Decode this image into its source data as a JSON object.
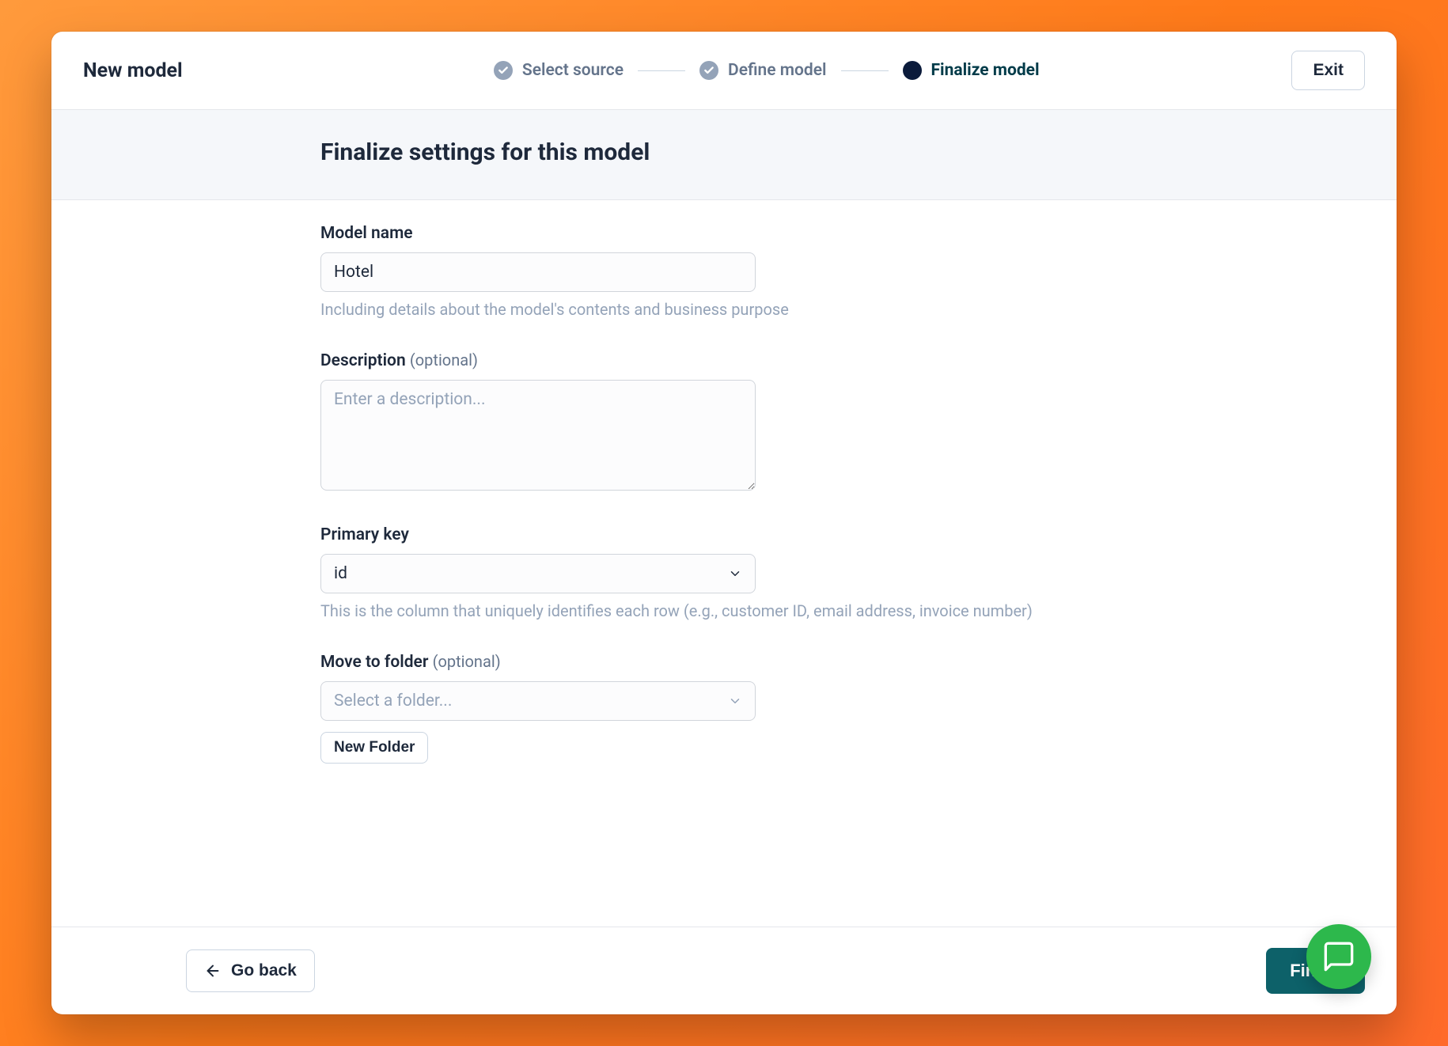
{
  "header": {
    "title": "New model",
    "exit_label": "Exit"
  },
  "stepper": {
    "steps": [
      {
        "label": "Select source",
        "state": "completed"
      },
      {
        "label": "Define model",
        "state": "completed"
      },
      {
        "label": "Finalize model",
        "state": "active"
      }
    ]
  },
  "page": {
    "heading": "Finalize settings for this model"
  },
  "form": {
    "model_name": {
      "label": "Model name",
      "value": "Hotel",
      "help": "Including details about the model's contents and business purpose"
    },
    "description": {
      "label": "Description",
      "optional_text": "(optional)",
      "placeholder": "Enter a description...",
      "value": ""
    },
    "primary_key": {
      "label": "Primary key",
      "value": "id",
      "help": "This is the column that uniquely identifies each row (e.g., customer ID, email address, invoice number)"
    },
    "move_to_folder": {
      "label": "Move to folder",
      "optional_text": "(optional)",
      "placeholder": "Select a folder...",
      "new_folder_label": "New Folder"
    }
  },
  "footer": {
    "go_back_label": "Go back",
    "finish_label": "Finish"
  }
}
